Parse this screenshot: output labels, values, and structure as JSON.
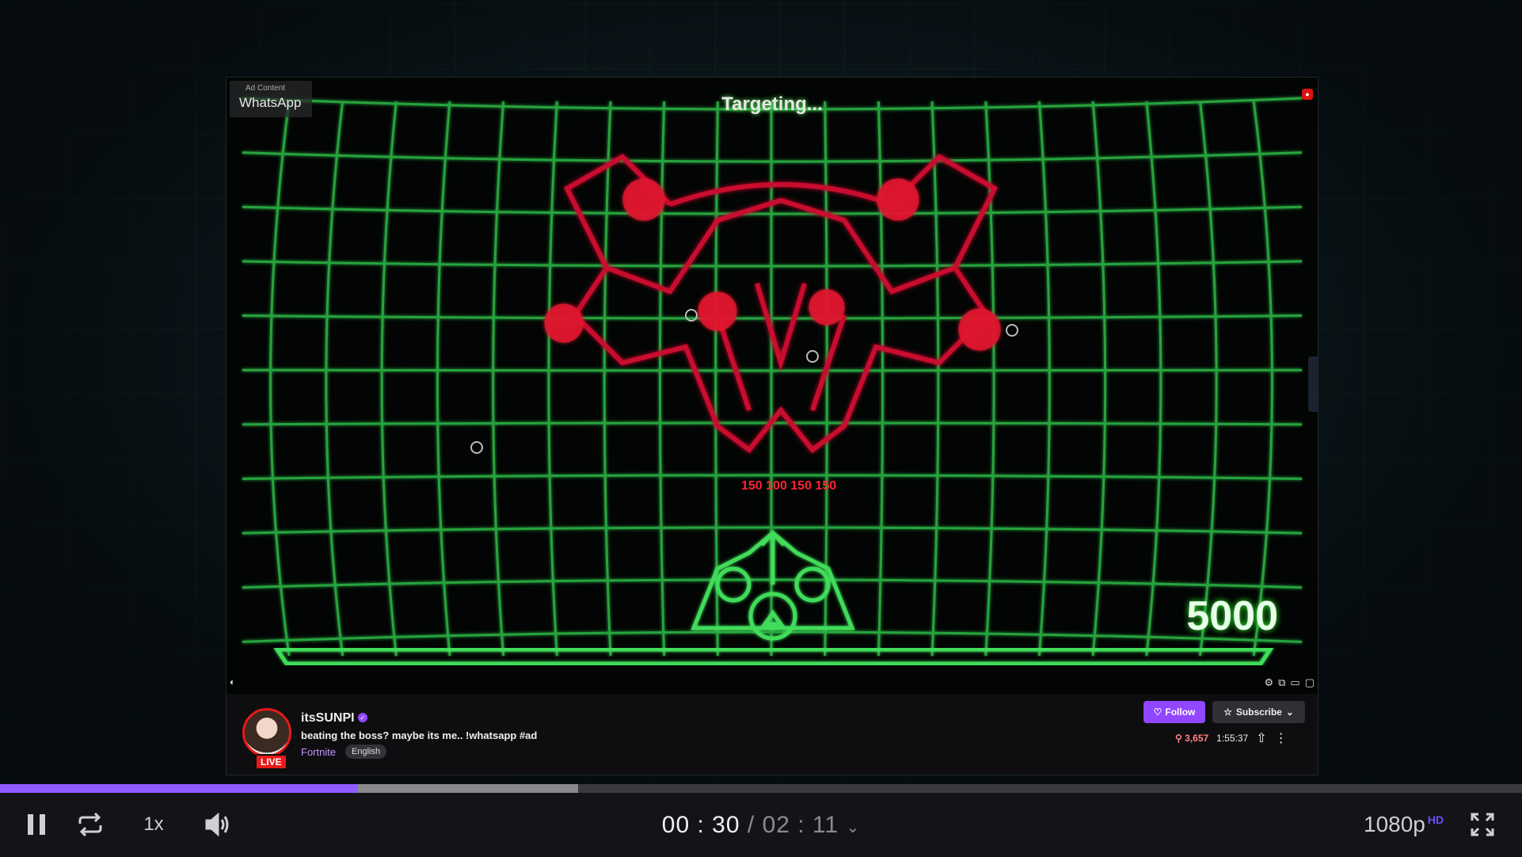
{
  "ad": {
    "label": "Ad Content",
    "brand": "WhatsApp"
  },
  "game": {
    "status_text": "Targeting...",
    "score": "5000",
    "damage_text": "150 100 150 150"
  },
  "stream": {
    "channel_name": "itsSUNPI",
    "live_badge": "LIVE",
    "title": "beating the boss? maybe its me.. !whatsapp #ad",
    "category": "Fortnite",
    "tag": "English",
    "follow_label": "Follow",
    "subscribe_label": "Subscribe",
    "viewers": "3,657",
    "uptime": "1:55:37"
  },
  "player": {
    "speed": "1x",
    "current_time": "00 : 30",
    "separator": "/",
    "duration": "02 : 11",
    "quality": "1080p",
    "quality_badge": "HD",
    "played_fraction": 0.235,
    "buffered_fraction": 0.38
  },
  "colors": {
    "accent": "#9147ff",
    "live_red": "#e91916",
    "grid_green": "#2fbf4a",
    "boss_red": "#c8102e"
  },
  "icons": [
    "pause-icon",
    "repeat-icon",
    "volume-icon",
    "chevron-down-icon",
    "fullscreen-icon",
    "heart-icon",
    "star-icon",
    "share-icon",
    "more-icon",
    "settings-icon",
    "viewer-icon"
  ]
}
